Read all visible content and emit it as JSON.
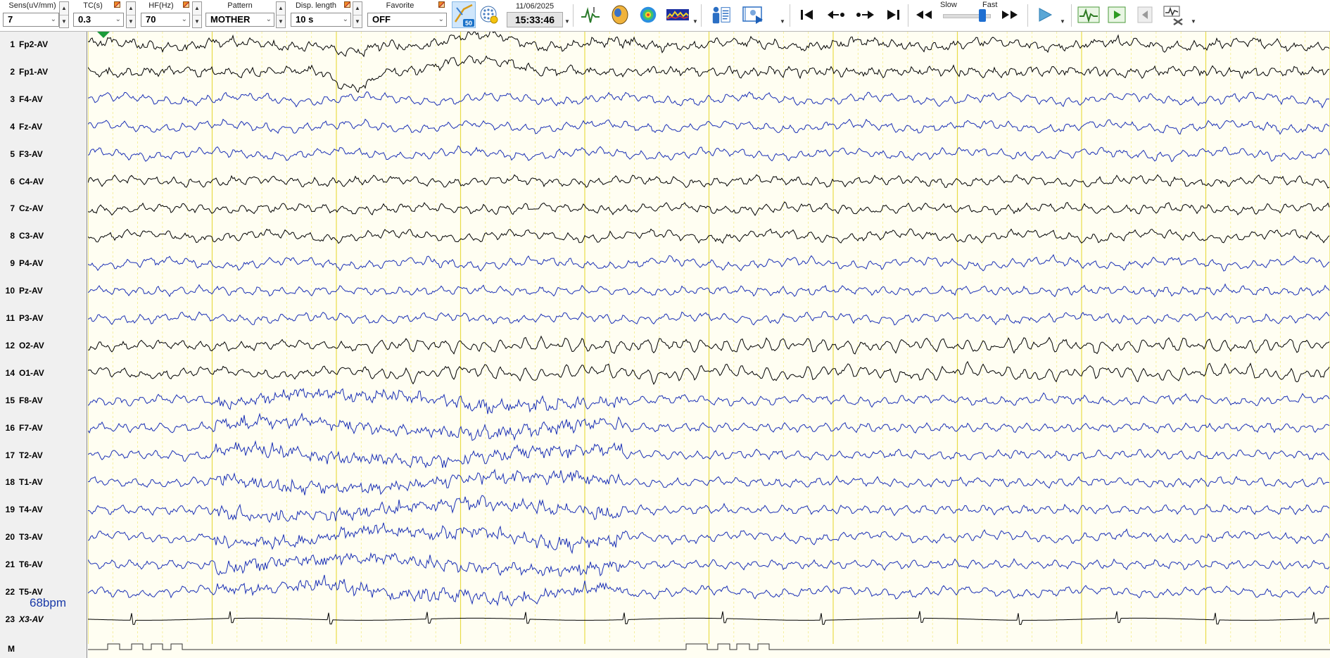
{
  "toolbar": {
    "sens": {
      "label": "Sens(uV/mm)",
      "value": "7"
    },
    "tc": {
      "label": "TC(s)",
      "value": "0.3"
    },
    "hf": {
      "label": "HF(Hz)",
      "value": "70"
    },
    "pattern": {
      "label": "Pattern",
      "value": "MOTHER"
    },
    "disp_length": {
      "label": "Disp. length",
      "value": "10 s"
    },
    "favorite": {
      "label": "Favorite",
      "value": "OFF"
    },
    "filter_badge": "50",
    "date": "11/06/2025",
    "time": "15:33:46",
    "speed": {
      "slow_label": "Slow",
      "fast_label": "Fast",
      "level": 0.85
    }
  },
  "icons": [
    "waveform-select-icon",
    "head-map-icon",
    "topography-icon",
    "spectrum-icon",
    "patient-info-icon",
    "video-icon",
    "first-page-icon",
    "step-back-icon",
    "step-forward-icon",
    "last-page-icon",
    "rewind-icon",
    "fast-forward-icon",
    "play-icon",
    "montage-wave-icon",
    "record-play-icon",
    "prev-frame-icon",
    "tools-icon"
  ],
  "channels": [
    {
      "num": "1",
      "name": "Fp2-AV",
      "color": "#000000"
    },
    {
      "num": "2",
      "name": "Fp1-AV",
      "color": "#000000"
    },
    {
      "num": "3",
      "name": "F4-AV",
      "color": "#1a2fb5"
    },
    {
      "num": "4",
      "name": "Fz-AV",
      "color": "#1a2fb5"
    },
    {
      "num": "5",
      "name": "F3-AV",
      "color": "#1a2fb5"
    },
    {
      "num": "6",
      "name": "C4-AV",
      "color": "#000000"
    },
    {
      "num": "7",
      "name": "Cz-AV",
      "color": "#000000"
    },
    {
      "num": "8",
      "name": "C3-AV",
      "color": "#000000"
    },
    {
      "num": "9",
      "name": "P4-AV",
      "color": "#1a2fb5"
    },
    {
      "num": "10",
      "name": "Pz-AV",
      "color": "#1a2fb5"
    },
    {
      "num": "11",
      "name": "P3-AV",
      "color": "#1a2fb5"
    },
    {
      "num": "12",
      "name": "O2-AV",
      "color": "#000000"
    },
    {
      "num": "14",
      "name": "O1-AV",
      "color": "#000000"
    },
    {
      "num": "15",
      "name": "F8-AV",
      "color": "#1a2fb5"
    },
    {
      "num": "16",
      "name": "F7-AV",
      "color": "#1a2fb5"
    },
    {
      "num": "17",
      "name": "T2-AV",
      "color": "#1a2fb5"
    },
    {
      "num": "18",
      "name": "T1-AV",
      "color": "#1a2fb5"
    },
    {
      "num": "19",
      "name": "T4-AV",
      "color": "#1a2fb5"
    },
    {
      "num": "20",
      "name": "T3-AV",
      "color": "#1a2fb5"
    },
    {
      "num": "21",
      "name": "T6-AV",
      "color": "#1a2fb5"
    },
    {
      "num": "22",
      "name": "T5-AV",
      "color": "#1a2fb5"
    },
    {
      "num": "23",
      "name": "X3-AV",
      "color": "#000000"
    },
    {
      "num": "M",
      "name": "",
      "color": "#000000"
    }
  ],
  "heart_rate": "68bpm",
  "colors": {
    "trace_background": "#fffef2",
    "grid_minor": "#f3ec8a",
    "grid_major": "#e8dc4a",
    "marker": "#1a9b3a"
  }
}
